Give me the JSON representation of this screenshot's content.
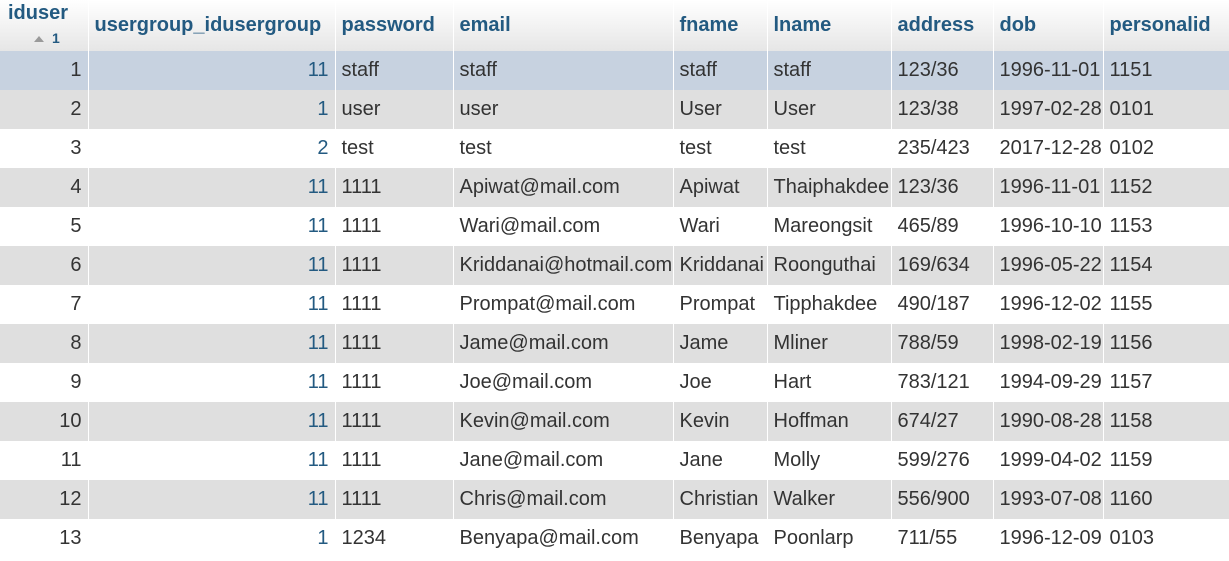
{
  "table": {
    "columns": [
      {
        "key": "iduser",
        "label": "iduser",
        "sort_order": "1"
      },
      {
        "key": "usergroup",
        "label": "usergroup_idusergroup"
      },
      {
        "key": "password",
        "label": "password"
      },
      {
        "key": "email",
        "label": "email"
      },
      {
        "key": "fname",
        "label": "fname"
      },
      {
        "key": "lname",
        "label": "lname"
      },
      {
        "key": "address",
        "label": "address"
      },
      {
        "key": "dob",
        "label": "dob"
      },
      {
        "key": "personalid",
        "label": "personalid"
      }
    ],
    "rows": [
      {
        "iduser": "1",
        "usergroup": "11",
        "password": "staff",
        "email": "staff",
        "fname": "staff",
        "lname": "staff",
        "address": "123/36",
        "dob": "1996-11-01",
        "personalid": "1151"
      },
      {
        "iduser": "2",
        "usergroup": "1",
        "password": "user",
        "email": "user",
        "fname": "User",
        "lname": "User",
        "address": "123/38",
        "dob": "1997-02-28",
        "personalid": "0101"
      },
      {
        "iduser": "3",
        "usergroup": "2",
        "password": "test",
        "email": "test",
        "fname": "test",
        "lname": "test",
        "address": "235/423",
        "dob": "2017-12-28",
        "personalid": "0102"
      },
      {
        "iduser": "4",
        "usergroup": "11",
        "password": "1111",
        "email": "Apiwat@mail.com",
        "fname": "Apiwat",
        "lname": "Thaiphakdee",
        "address": "123/36",
        "dob": "1996-11-01",
        "personalid": "1152"
      },
      {
        "iduser": "5",
        "usergroup": "11",
        "password": "1111",
        "email": "Wari@mail.com",
        "fname": "Wari",
        "lname": "Mareongsit",
        "address": "465/89",
        "dob": "1996-10-10",
        "personalid": "1153"
      },
      {
        "iduser": "6",
        "usergroup": "11",
        "password": "1111",
        "email": "Kriddanai@hotmail.com",
        "fname": "Kriddanai",
        "lname": "Roonguthai",
        "address": "169/634",
        "dob": "1996-05-22",
        "personalid": "1154"
      },
      {
        "iduser": "7",
        "usergroup": "11",
        "password": "1111",
        "email": "Prompat@mail.com",
        "fname": "Prompat",
        "lname": "Tipphakdee",
        "address": "490/187",
        "dob": "1996-12-02",
        "personalid": "1155"
      },
      {
        "iduser": "8",
        "usergroup": "11",
        "password": "1111",
        "email": "Jame@mail.com",
        "fname": "Jame",
        "lname": "Mliner",
        "address": "788/59",
        "dob": "1998-02-19",
        "personalid": "1156"
      },
      {
        "iduser": "9",
        "usergroup": "11",
        "password": "1111",
        "email": "Joe@mail.com",
        "fname": "Joe",
        "lname": "Hart",
        "address": "783/121",
        "dob": "1994-09-29",
        "personalid": "1157"
      },
      {
        "iduser": "10",
        "usergroup": "11",
        "password": "1111",
        "email": "Kevin@mail.com",
        "fname": "Kevin",
        "lname": "Hoffman",
        "address": "674/27",
        "dob": "1990-08-28",
        "personalid": "1158"
      },
      {
        "iduser": "11",
        "usergroup": "11",
        "password": "1111",
        "email": "Jane@mail.com",
        "fname": "Jane",
        "lname": "Molly",
        "address": "599/276",
        "dob": "1999-04-02",
        "personalid": "1159"
      },
      {
        "iduser": "12",
        "usergroup": "11",
        "password": "1111",
        "email": "Chris@mail.com",
        "fname": "Christian",
        "lname": "Walker",
        "address": "556/900",
        "dob": "1993-07-08",
        "personalid": "1160"
      },
      {
        "iduser": "13",
        "usergroup": "1",
        "password": "1234",
        "email": "Benyapa@mail.com",
        "fname": "Benyapa",
        "lname": "Poonlarp",
        "address": "711/55",
        "dob": "1996-12-09",
        "personalid": "0103"
      }
    ]
  },
  "colors": {
    "header_text": "#235a81",
    "row_alt": "#dfdfdf",
    "row_highlight": "#c7d2e0"
  }
}
